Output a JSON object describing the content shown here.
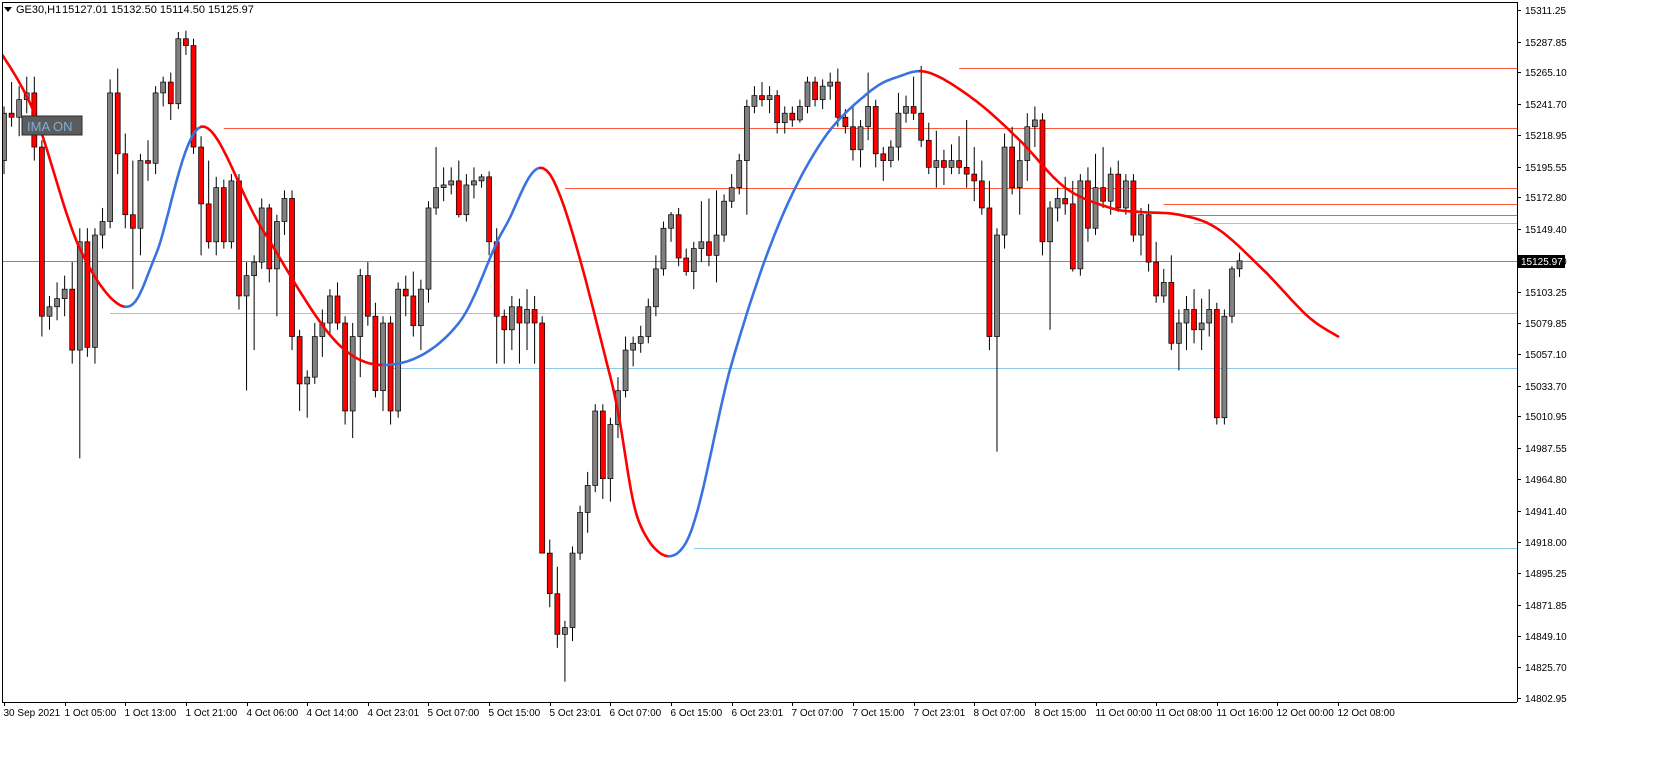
{
  "header": {
    "symbol": "GE30,H1",
    "ohlc": "15127.01 15132.50 15114.50 15125.97"
  },
  "indicator_button": {
    "label": "IMA ON"
  },
  "colors": {
    "bull": "#808080",
    "bear": "#ff0000",
    "ma_down": "#ff0000",
    "ma_up": "#3a73e0",
    "resistance": "#ff5a3c",
    "support": "#8ccbe6",
    "current": "#6c8fa3"
  },
  "chart_data": {
    "type": "candlestick",
    "y_axis": {
      "min": 14792,
      "max": 15320,
      "ticks": [
        "15311.25",
        "15287.85",
        "15265.10",
        "15241.70",
        "15218.95",
        "15195.55",
        "15172.80",
        "15149.40",
        "15126.00",
        "15103.25",
        "15079.85",
        "15057.10",
        "15033.70",
        "15010.95",
        "14987.55",
        "14964.80",
        "14941.40",
        "14918.00",
        "14895.25",
        "14871.85",
        "14849.10",
        "14825.70",
        "14802.95"
      ]
    },
    "x_axis": {
      "labels": [
        {
          "index": 0,
          "text": "30 Sep 2021"
        },
        {
          "index": 8,
          "text": "1 Oct 05:00"
        },
        {
          "index": 16,
          "text": "1 Oct 13:00"
        },
        {
          "index": 24,
          "text": "1 Oct 21:00"
        },
        {
          "index": 32,
          "text": "4 Oct 06:00"
        },
        {
          "index": 40,
          "text": "4 Oct 14:00"
        },
        {
          "index": 48,
          "text": "4 Oct 23:01"
        },
        {
          "index": 56,
          "text": "5 Oct 07:00"
        },
        {
          "index": 64,
          "text": "5 Oct 15:00"
        },
        {
          "index": 72,
          "text": "5 Oct 23:01"
        },
        {
          "index": 80,
          "text": "6 Oct 07:00"
        },
        {
          "index": 88,
          "text": "6 Oct 15:00"
        },
        {
          "index": 96,
          "text": "6 Oct 23:01"
        },
        {
          "index": 104,
          "text": "7 Oct 07:00"
        },
        {
          "index": 112,
          "text": "7 Oct 15:00"
        },
        {
          "index": 120,
          "text": "7 Oct 23:01"
        },
        {
          "index": 128,
          "text": "8 Oct 07:00"
        },
        {
          "index": 136,
          "text": "8 Oct 15:00"
        },
        {
          "index": 144,
          "text": "11 Oct 00:00"
        },
        {
          "index": 152,
          "text": "11 Oct 08:00"
        },
        {
          "index": 160,
          "text": "11 Oct 16:00"
        },
        {
          "index": 168,
          "text": "12 Oct 00:00"
        },
        {
          "index": 176,
          "text": "12 Oct 08:00"
        }
      ]
    },
    "current_price": 15125.97,
    "current_price_label": "15125.97",
    "horizontal_levels": [
      {
        "price": 15268.5,
        "start_index": 126,
        "kind": "resistance"
      },
      {
        "price": 15224.0,
        "start_index": 29,
        "kind": "resistance"
      },
      {
        "price": 15180.0,
        "start_index": 74,
        "kind": "resistance"
      },
      {
        "price": 15168.0,
        "start_index": 153,
        "kind": "resistance"
      },
      {
        "price": 15160.0,
        "start_index": 155,
        "kind": "resistance"
      },
      {
        "price": 15154.0,
        "start_index": 157,
        "kind": "support"
      },
      {
        "price": 15087.5,
        "start_index": 14,
        "kind": "support"
      },
      {
        "price": 15047.0,
        "start_index": 51,
        "kind": "support"
      },
      {
        "price": 14914.0,
        "start_index": 91,
        "kind": "support"
      }
    ],
    "ohlc": [
      [
        15200,
        15240,
        15190,
        15235
      ],
      [
        15235,
        15258,
        15225,
        15232
      ],
      [
        15232,
        15255,
        15218,
        15245
      ],
      [
        15245,
        15262,
        15235,
        15250
      ],
      [
        15250,
        15262,
        15200,
        15210
      ],
      [
        15210,
        15215,
        15070,
        15085
      ],
      [
        15085,
        15100,
        15075,
        15092
      ],
      [
        15092,
        15110,
        15082,
        15098
      ],
      [
        15098,
        15115,
        15085,
        15105
      ],
      [
        15105,
        15125,
        15050,
        15060
      ],
      [
        15060,
        15150,
        14980,
        15140
      ],
      [
        15140,
        15150,
        15055,
        15062
      ],
      [
        15062,
        15150,
        15050,
        15145
      ],
      [
        15145,
        15165,
        15135,
        15155
      ],
      [
        15155,
        15260,
        15150,
        15250
      ],
      [
        15250,
        15268,
        15190,
        15205
      ],
      [
        15205,
        15220,
        15150,
        15160
      ],
      [
        15160,
        15200,
        15105,
        15150
      ],
      [
        15150,
        15205,
        15130,
        15200
      ],
      [
        15200,
        15215,
        15185,
        15198
      ],
      [
        15198,
        15255,
        15190,
        15250
      ],
      [
        15250,
        15262,
        15240,
        15258
      ],
      [
        15258,
        15265,
        15230,
        15242
      ],
      [
        15242,
        15295,
        15238,
        15290
      ],
      [
        15290,
        15296,
        15278,
        15285
      ],
      [
        15285,
        15290,
        15205,
        15210
      ],
      [
        15210,
        15218,
        15130,
        15168
      ],
      [
        15168,
        15200,
        15135,
        15140
      ],
      [
        15140,
        15188,
        15130,
        15180
      ],
      [
        15180,
        15186,
        15135,
        15140
      ],
      [
        15140,
        15190,
        15135,
        15185
      ],
      [
        15185,
        15190,
        15090,
        15100
      ],
      [
        15100,
        15125,
        15030,
        15115
      ],
      [
        15115,
        15130,
        15060,
        15125
      ],
      [
        15125,
        15172,
        15120,
        15165
      ],
      [
        15165,
        15168,
        15110,
        15120
      ],
      [
        15120,
        15160,
        15085,
        15155
      ],
      [
        15155,
        15178,
        15145,
        15172
      ],
      [
        15172,
        15178,
        15060,
        15070
      ],
      [
        15070,
        15075,
        15015,
        15035
      ],
      [
        15035,
        15045,
        15010,
        15040
      ],
      [
        15040,
        15080,
        15035,
        15070
      ],
      [
        15070,
        15090,
        15055,
        15080
      ],
      [
        15080,
        15105,
        15070,
        15100
      ],
      [
        15100,
        15110,
        15075,
        15080
      ],
      [
        15080,
        15085,
        15005,
        15015
      ],
      [
        15015,
        15080,
        14995,
        15070
      ],
      [
        15070,
        15120,
        15040,
        15115
      ],
      [
        15115,
        15125,
        15078,
        15085
      ],
      [
        15085,
        15095,
        15025,
        15030
      ],
      [
        15030,
        15085,
        15015,
        15080
      ],
      [
        15080,
        15085,
        15005,
        15015
      ],
      [
        15015,
        15110,
        15010,
        15105
      ],
      [
        15105,
        15115,
        15085,
        15100
      ],
      [
        15100,
        15118,
        15070,
        15078
      ],
      [
        15078,
        15112,
        15060,
        15105
      ],
      [
        15105,
        15170,
        15095,
        15165
      ],
      [
        15165,
        15210,
        15160,
        15180
      ],
      [
        15180,
        15195,
        15170,
        15182
      ],
      [
        15182,
        15195,
        15175,
        15185
      ],
      [
        15185,
        15200,
        15158,
        15160
      ],
      [
        15160,
        15190,
        15155,
        15182
      ],
      [
        15182,
        15195,
        15172,
        15185
      ],
      [
        15185,
        15190,
        15180,
        15188
      ],
      [
        15188,
        15192,
        15130,
        15140
      ],
      [
        15140,
        15150,
        15050,
        15085
      ],
      [
        15085,
        15090,
        15050,
        15075
      ],
      [
        15075,
        15100,
        15060,
        15092
      ],
      [
        15092,
        15098,
        15050,
        15080
      ],
      [
        15080,
        15105,
        15060,
        15090
      ],
      [
        15090,
        15100,
        15050,
        15080
      ],
      [
        15080,
        15085,
        14920,
        14910
      ],
      [
        14910,
        14920,
        14870,
        14880
      ],
      [
        14880,
        14900,
        14840,
        14850
      ],
      [
        14850,
        14860,
        14815,
        14855
      ],
      [
        14855,
        14915,
        14845,
        14910
      ],
      [
        14910,
        14945,
        14905,
        14940
      ],
      [
        14940,
        14970,
        14925,
        14960
      ],
      [
        14960,
        15020,
        14955,
        15015
      ],
      [
        15015,
        15020,
        14950,
        14965
      ],
      [
        14965,
        15010,
        14948,
        15005
      ],
      [
        15005,
        15040,
        14995,
        15030
      ],
      [
        15030,
        15070,
        15025,
        15060
      ],
      [
        15060,
        15070,
        15048,
        15065
      ],
      [
        15065,
        15078,
        15058,
        15070
      ],
      [
        15070,
        15098,
        15065,
        15092
      ],
      [
        15092,
        15130,
        15085,
        15120
      ],
      [
        15120,
        15155,
        15115,
        15150
      ],
      [
        15150,
        15162,
        15140,
        15160
      ],
      [
        15160,
        15165,
        15122,
        15128
      ],
      [
        15128,
        15135,
        15115,
        15118
      ],
      [
        15118,
        15140,
        15105,
        15135
      ],
      [
        15135,
        15170,
        15125,
        15140
      ],
      [
        15140,
        15172,
        15122,
        15130
      ],
      [
        15130,
        15178,
        15110,
        15145
      ],
      [
        15145,
        15175,
        15140,
        15170
      ],
      [
        15170,
        15190,
        15165,
        15180
      ],
      [
        15180,
        15205,
        15175,
        15200
      ],
      [
        15200,
        15245,
        15160,
        15240
      ],
      [
        15240,
        15255,
        15235,
        15248
      ],
      [
        15248,
        15258,
        15240,
        15245
      ],
      [
        15245,
        15255,
        15235,
        15248
      ],
      [
        15248,
        15252,
        15220,
        15228
      ],
      [
        15228,
        15240,
        15220,
        15235
      ],
      [
        15235,
        15240,
        15225,
        15230
      ],
      [
        15230,
        15245,
        15228,
        15240
      ],
      [
        15240,
        15262,
        15235,
        15258
      ],
      [
        15258,
        15262,
        15240,
        15245
      ],
      [
        15245,
        15260,
        15238,
        15255
      ],
      [
        15255,
        15265,
        15245,
        15258
      ],
      [
        15258,
        15268,
        15225,
        15232
      ],
      [
        15232,
        15238,
        15220,
        15225
      ],
      [
        15225,
        15240,
        15200,
        15208
      ],
      [
        15208,
        15230,
        15195,
        15225
      ],
      [
        15225,
        15265,
        15215,
        15240
      ],
      [
        15240,
        15245,
        15195,
        15205
      ],
      [
        15205,
        15210,
        15185,
        15200
      ],
      [
        15200,
        15215,
        15195,
        15210
      ],
      [
        15210,
        15250,
        15200,
        15235
      ],
      [
        15235,
        15248,
        15228,
        15240
      ],
      [
        15240,
        15262,
        15230,
        15235
      ],
      [
        15235,
        15270,
        15210,
        15215
      ],
      [
        15215,
        15228,
        15190,
        15195
      ],
      [
        15195,
        15222,
        15180,
        15200
      ],
      [
        15200,
        15208,
        15182,
        15195
      ],
      [
        15195,
        15212,
        15190,
        15200
      ],
      [
        15200,
        15218,
        15190,
        15195
      ],
      [
        15195,
        15230,
        15180,
        15190
      ],
      [
        15190,
        15210,
        15170,
        15185
      ],
      [
        15185,
        15200,
        15160,
        15165
      ],
      [
        15165,
        15185,
        15060,
        15070
      ],
      [
        15070,
        15150,
        14985,
        15145
      ],
      [
        15145,
        15220,
        15135,
        15210
      ],
      [
        15210,
        15225,
        15175,
        15180
      ],
      [
        15180,
        15215,
        15160,
        15200
      ],
      [
        15200,
        15235,
        15185,
        15225
      ],
      [
        15225,
        15240,
        15210,
        15230
      ],
      [
        15230,
        15235,
        15130,
        15140
      ],
      [
        15140,
        15170,
        15075,
        15165
      ],
      [
        15165,
        15180,
        15155,
        15172
      ],
      [
        15172,
        15188,
        15160,
        15168
      ],
      [
        15168,
        15185,
        15118,
        15120
      ],
      [
        15120,
        15190,
        15115,
        15185
      ],
      [
        15185,
        15195,
        15140,
        15150
      ],
      [
        15150,
        15205,
        15145,
        15180
      ],
      [
        15180,
        15210,
        15165,
        15170
      ],
      [
        15170,
        15195,
        15160,
        15190
      ],
      [
        15190,
        15200,
        15162,
        15165
      ],
      [
        15165,
        15190,
        15160,
        15185
      ],
      [
        15185,
        15190,
        15140,
        15145
      ],
      [
        15145,
        15165,
        15130,
        15160
      ],
      [
        15160,
        15168,
        15118,
        15125
      ],
      [
        15125,
        15140,
        15095,
        15100
      ],
      [
        15100,
        15120,
        15095,
        15110
      ],
      [
        15110,
        15130,
        15060,
        15065
      ],
      [
        15065,
        15090,
        15045,
        15080
      ],
      [
        15080,
        15100,
        15060,
        15090
      ],
      [
        15090,
        15105,
        15065,
        15075
      ],
      [
        15075,
        15098,
        15060,
        15080
      ],
      [
        15080,
        15105,
        15070,
        15090
      ],
      [
        15090,
        15095,
        15005,
        15010
      ],
      [
        15010,
        15090,
        15005,
        15085
      ],
      [
        15085,
        15122,
        15080,
        15120
      ],
      [
        15120,
        15132,
        15114,
        15125.97
      ]
    ],
    "ma_points": [
      [
        -1,
        15285
      ],
      [
        4,
        15235
      ],
      [
        10,
        15135
      ],
      [
        16,
        15092
      ],
      [
        20,
        15130
      ],
      [
        26,
        15225
      ],
      [
        34,
        15150
      ],
      [
        44,
        15065
      ],
      [
        52,
        15050
      ],
      [
        60,
        15080
      ],
      [
        66,
        15150
      ],
      [
        72,
        15190
      ],
      [
        80,
        15040
      ],
      [
        84,
        14930
      ],
      [
        90,
        14918
      ],
      [
        96,
        15050
      ],
      [
        102,
        15150
      ],
      [
        108,
        15215
      ],
      [
        114,
        15250
      ],
      [
        118,
        15262
      ],
      [
        122,
        15265
      ],
      [
        128,
        15245
      ],
      [
        134,
        15215
      ],
      [
        140,
        15180
      ],
      [
        146,
        15165
      ],
      [
        150,
        15162
      ],
      [
        155,
        15160
      ],
      [
        160,
        15150
      ],
      [
        166,
        15120
      ],
      [
        172,
        15085
      ],
      [
        176,
        15070
      ]
    ]
  }
}
